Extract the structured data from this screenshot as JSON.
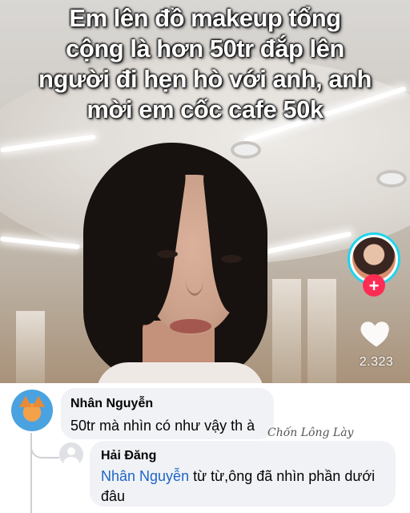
{
  "video": {
    "caption_lines": [
      "Em lên đồ makeup tổng",
      "cộng là hơn 50tr đắp lên",
      "người đi hẹn hò với anh, anh",
      "mời em cốc cafe 50k"
    ],
    "like_count": "2.323",
    "follow_symbol": "+"
  },
  "comments": {
    "top": {
      "author": "Nhân Nguyễn",
      "text": "50tr mà nhìn có như vậy th à"
    },
    "reply": {
      "author": "Hải Đăng",
      "mention": "Nhân Nguyễn",
      "text": " từ từ,ông đã nhìn phần dưới",
      "text_line2": "đâu"
    },
    "watermark": "Chốn Lông Lày"
  },
  "colors": {
    "mention": "#1f65c8",
    "follow": "#fe2c55",
    "avatar_ring": "#20d5ec",
    "bubble": "#f0f2f5"
  },
  "icons": [
    "heart-icon",
    "plus-icon",
    "default-avatar-icon"
  ]
}
